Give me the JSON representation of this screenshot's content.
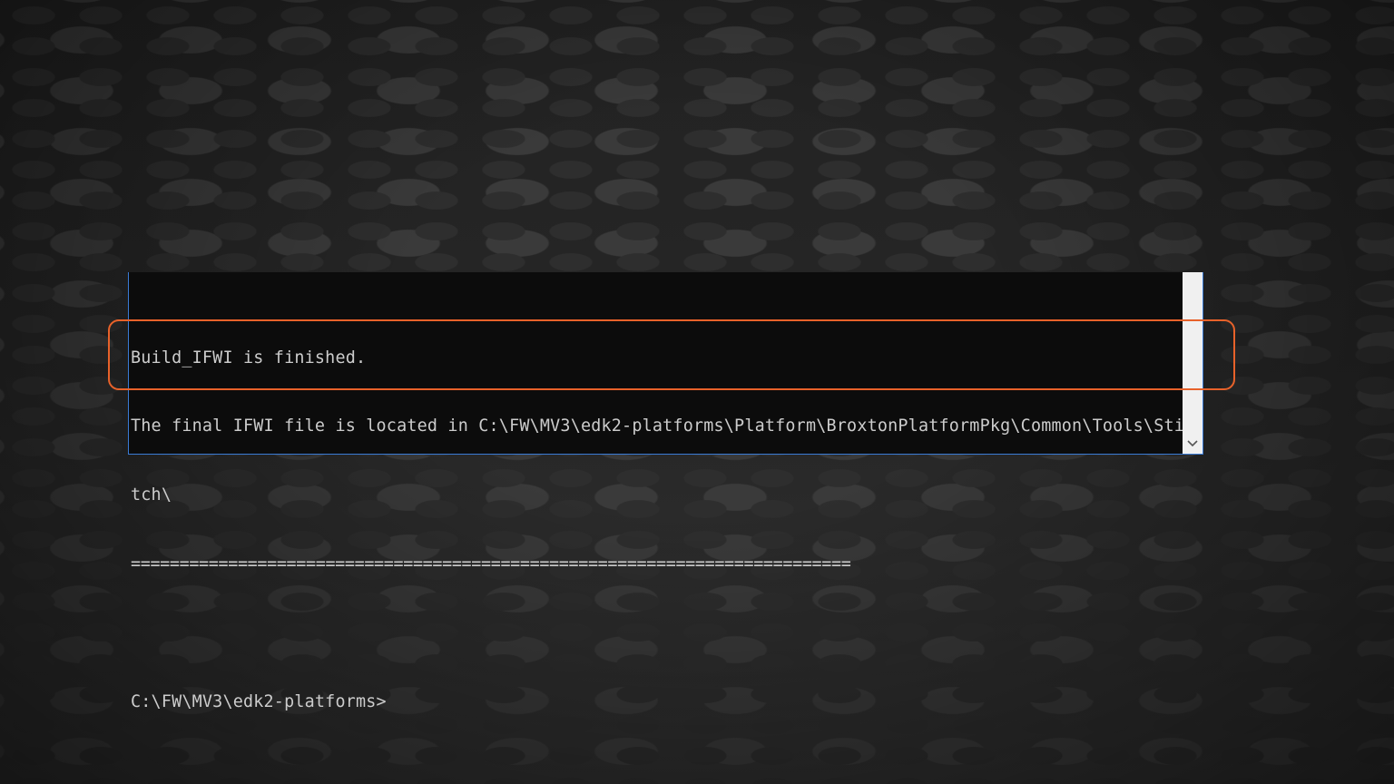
{
  "console": {
    "lines": [
      "Build_IFWI is finished.",
      "The final IFWI file is located in C:\\FW\\MV3\\edk2-platforms\\Platform\\BroxtonPlatformPkg\\Common\\Tools\\Sti",
      "tch\\",
      "==========================================================================",
      "",
      "C:\\FW\\MV3\\edk2-platforms>"
    ],
    "text_color": "#cccccc",
    "background_color": "#0c0c0c"
  },
  "scrollbar": {
    "down_arrow_icon": "chevron-down-icon"
  },
  "highlight": {
    "color": "#e8622a"
  }
}
